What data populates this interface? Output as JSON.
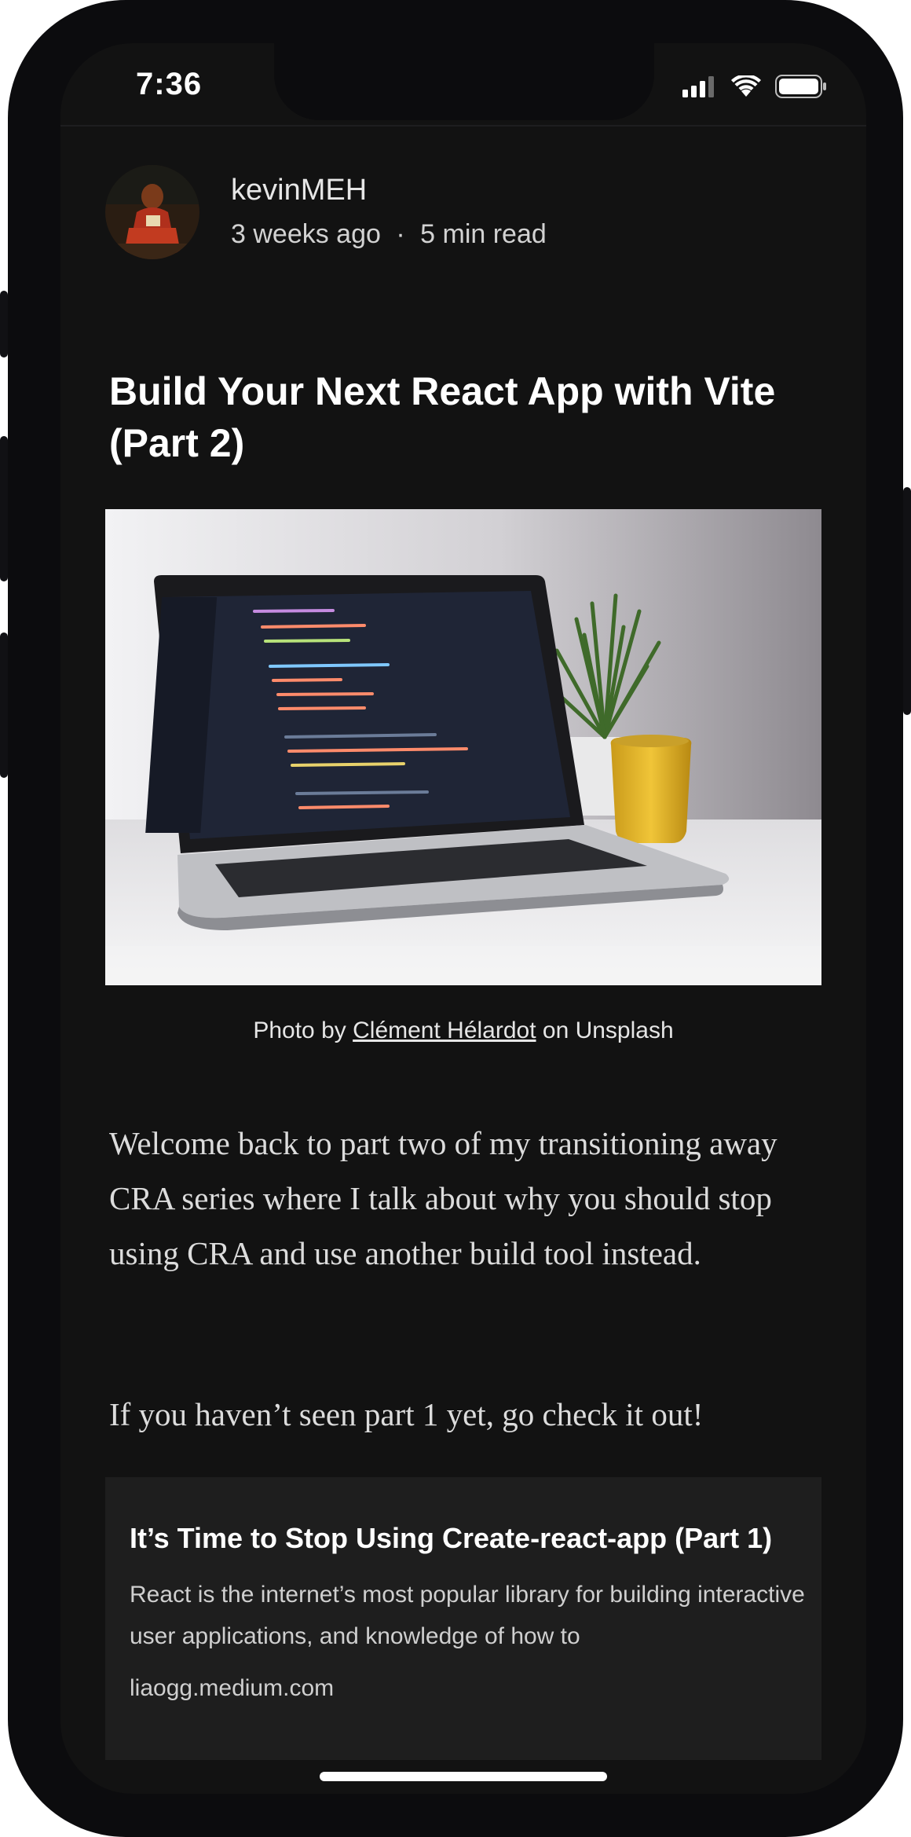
{
  "status_bar": {
    "time": "7:36",
    "icons": [
      "signal-icon",
      "wifi-icon",
      "battery-icon"
    ]
  },
  "author": {
    "name": "kevinMEH",
    "time_ago": "3 weeks ago",
    "separator": "·",
    "read_time": "5 min read"
  },
  "article": {
    "title": "Build Your Next React App with Vite (Part 2)",
    "caption_prefix": "Photo by ",
    "caption_link": "Clément Hélardot",
    "caption_suffix": " on Unsplash",
    "paragraphs": [
      "Welcome back to part two of my transitioning away CRA series where I talk about why you should stop using CRA and use another build tool instead.",
      "If you haven’t seen part 1 yet, go check it out!"
    ]
  },
  "link_card": {
    "title": "It’s Time to Stop Using Create-react-app (Part 1)",
    "description": "React is the internet’s most popular library for building interactive user applications, and knowledge of how to",
    "domain": "liaogg.medium.com"
  },
  "colors": {
    "background": "#121212",
    "card": "#1e1e1e",
    "text_primary": "#ffffff",
    "text_secondary": "#dcdcdc"
  }
}
